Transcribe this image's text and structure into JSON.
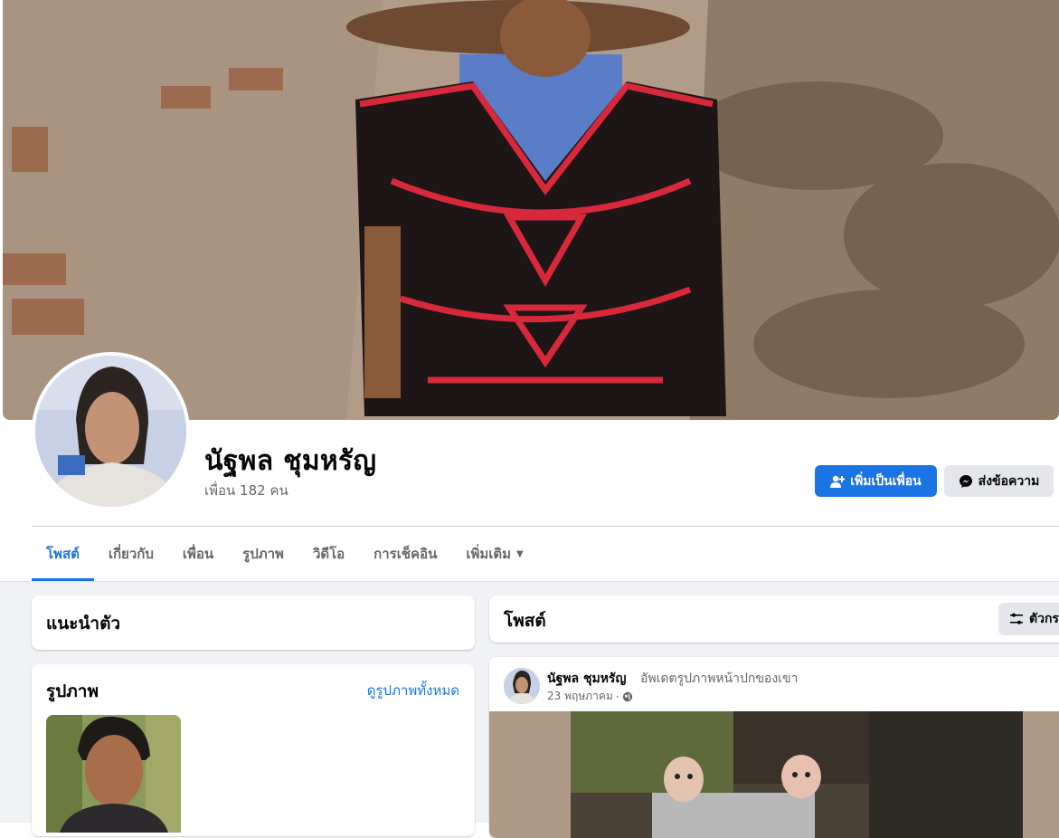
{
  "profile": {
    "name": "นัฐพล ชุมหรัญ",
    "friends_text": "เพื่อน 182 คน"
  },
  "actions": {
    "add_friend": "เพิ่มเป็นเพื่อน",
    "message": "ส่งข้อความ"
  },
  "tabs": [
    {
      "label": "โพสต์",
      "active": true
    },
    {
      "label": "เกี่ยวกับ"
    },
    {
      "label": "เพื่อน"
    },
    {
      "label": "รูปภาพ"
    },
    {
      "label": "วิดีโอ"
    },
    {
      "label": "การเช็คอิน"
    },
    {
      "label": "เพิ่มเติม"
    }
  ],
  "intro": {
    "title": "แนะนำตัว"
  },
  "photos": {
    "title": "รูปภาพ",
    "see_all": "ดูรูปภาพทั้งหมด"
  },
  "posts": {
    "title": "โพสต์",
    "filter_label": "ตัวกร"
  },
  "post": {
    "author": "นัฐพล ชุมหรัญ",
    "action": "อัพเดตรูปภาพหน้าปกของเขา",
    "date": "23 พฤษภาคม",
    "separator": "·",
    "privacy_icon": "globe-icon"
  },
  "colors": {
    "accent": "#1b74e4",
    "secondary_bg": "#e4e6eb",
    "page_bg": "#f0f2f5",
    "muted_text": "#65676b"
  }
}
